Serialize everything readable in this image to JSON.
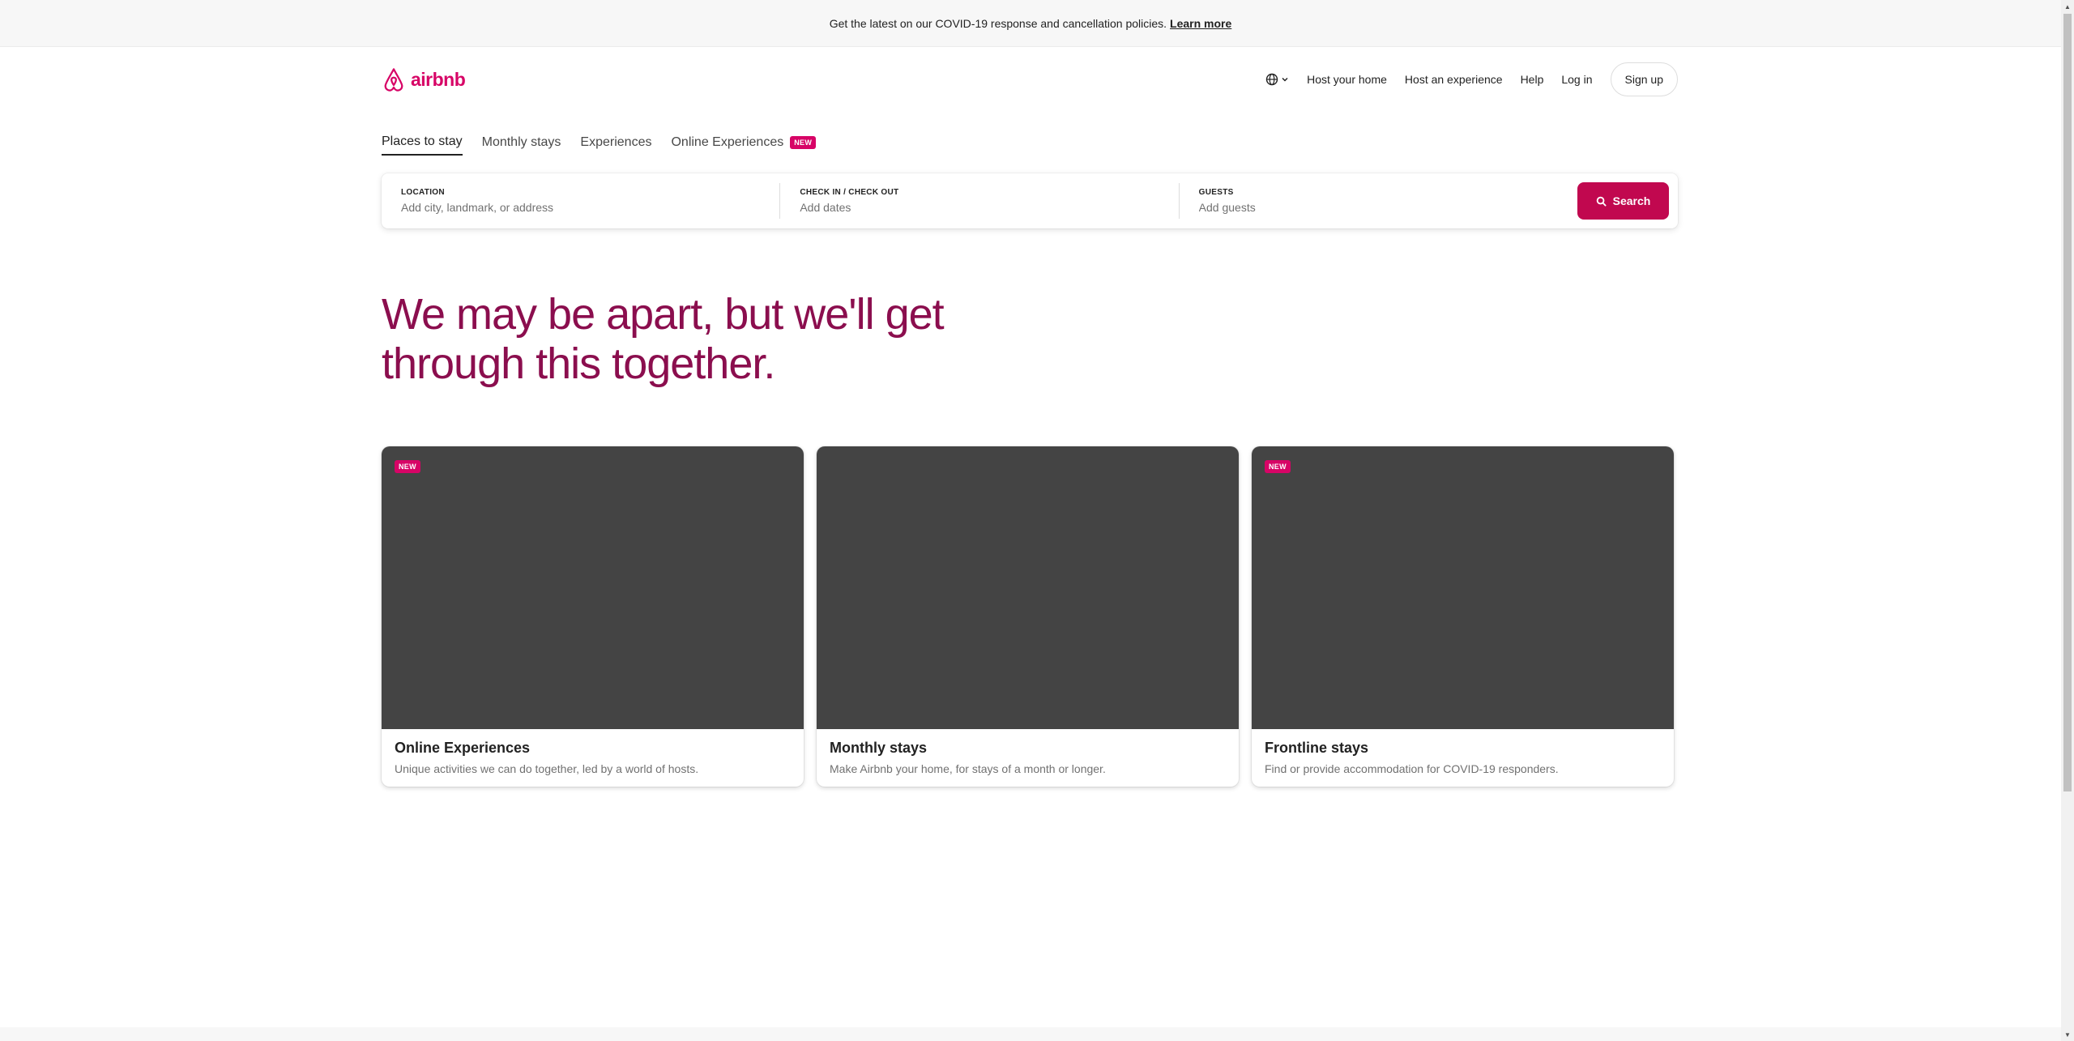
{
  "banner": {
    "text": "Get the latest on our COVID-19 response and cancellation policies.",
    "link": "Learn more"
  },
  "header": {
    "logo_text": "airbnb",
    "nav": {
      "host_home": "Host your home",
      "host_experience": "Host an experience",
      "help": "Help",
      "login": "Log in",
      "signup": "Sign up"
    }
  },
  "tabs": [
    {
      "label": "Places to stay",
      "active": true
    },
    {
      "label": "Monthly stays"
    },
    {
      "label": "Experiences"
    },
    {
      "label": "Online Experiences",
      "badge": "NEW"
    }
  ],
  "search": {
    "location_label": "LOCATION",
    "location_placeholder": "Add city, landmark, or address",
    "dates_label": "CHECK IN / CHECK OUT",
    "dates_placeholder": "Add dates",
    "guests_label": "GUESTS",
    "guests_placeholder": "Add guests",
    "button": "Search"
  },
  "headline": "We may be apart, but we'll get through this together.",
  "cards": [
    {
      "badge": "NEW",
      "title": "Online Experiences",
      "desc": "Unique activities we can do together, led by a world of hosts."
    },
    {
      "title": "Monthly stays",
      "desc": "Make Airbnb your home, for stays of a month or longer."
    },
    {
      "badge": "NEW",
      "title": "Frontline stays",
      "desc": "Find or provide accommodation for COVID-19 responders."
    }
  ],
  "colors": {
    "brand": "#d70466",
    "search_button": "#c1084f",
    "headline": "#8b0e4e",
    "card_image": "#444444"
  },
  "icons": [
    "airbnb-logo-icon",
    "globe-icon",
    "chevron-down-icon",
    "search-icon"
  ]
}
